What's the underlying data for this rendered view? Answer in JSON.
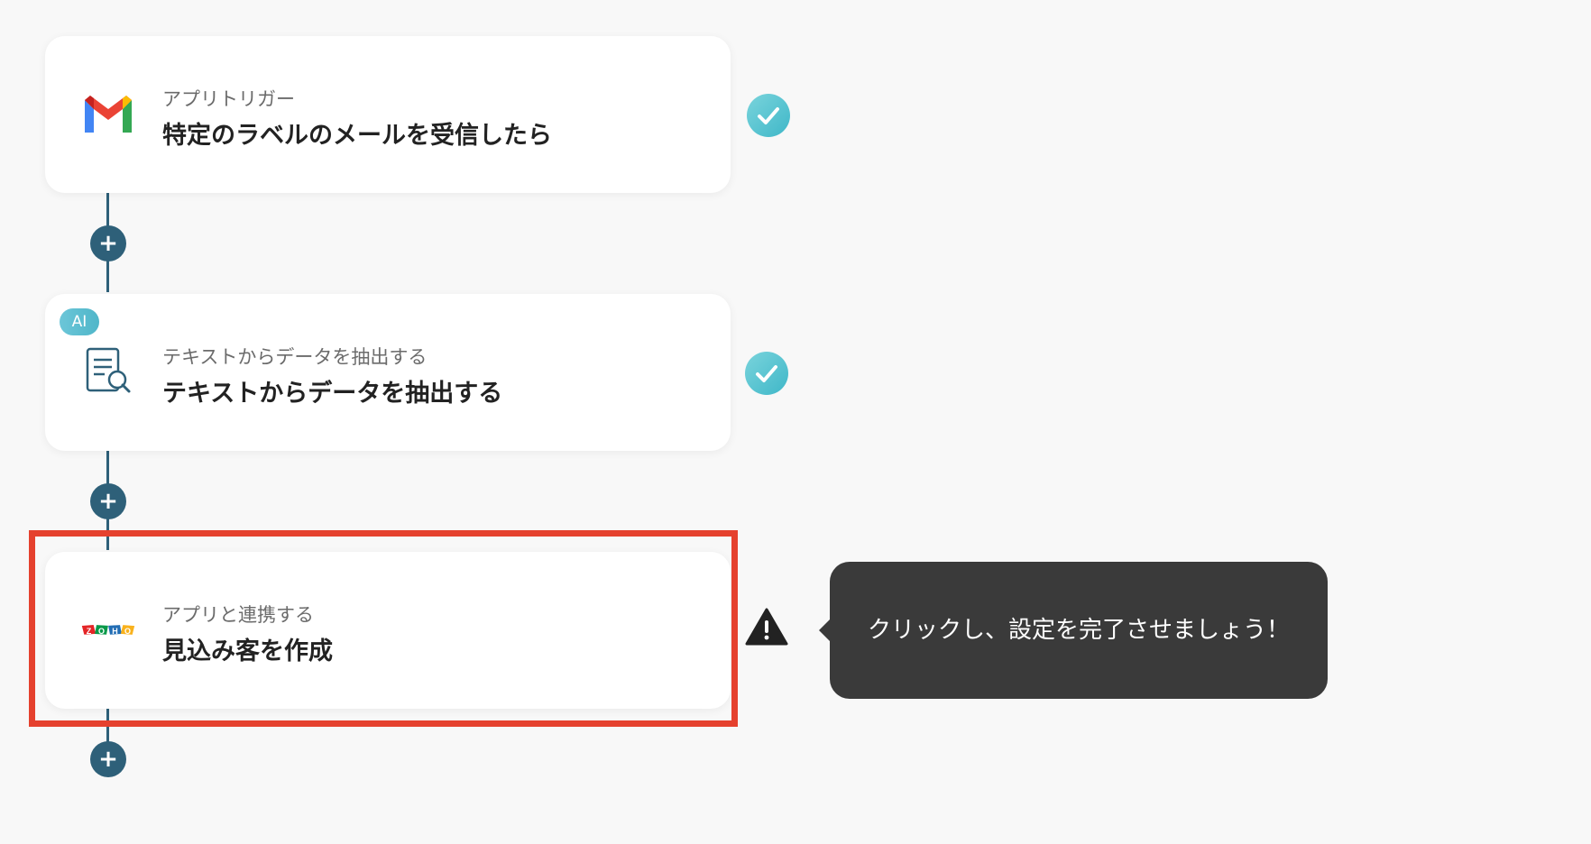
{
  "flow": {
    "steps": [
      {
        "subtitle": "アプリトリガー",
        "title": "特定のラベルのメールを受信したら",
        "icon": "gmail-icon",
        "status": "complete"
      },
      {
        "subtitle": "テキストからデータを抽出する",
        "title": "テキストからデータを抽出する",
        "icon": "document-search-icon",
        "badge": "AI",
        "status": "complete"
      },
      {
        "subtitle": "アプリと連携する",
        "title": "見込み客を作成",
        "icon": "zoho-icon",
        "status": "warning",
        "logo_letters": [
          "Z",
          "O",
          "H",
          "O"
        ]
      }
    ],
    "add_step_icon": "plus-icon"
  },
  "tooltip": {
    "text": "クリックし、設定を完了させましょう！"
  },
  "colors": {
    "connector": "#2e6079",
    "check": "#3fb7c8",
    "highlight": "#e5412e",
    "tooltip_bg": "#3a3a3a",
    "zoho_red": "#e42527",
    "zoho_green": "#089949",
    "zoho_blue": "#226db4",
    "zoho_yellow": "#f9b21d"
  }
}
